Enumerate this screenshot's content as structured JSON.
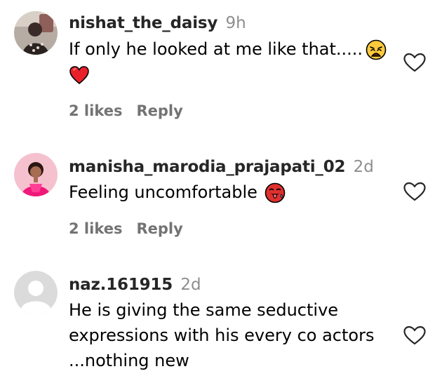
{
  "comments": [
    {
      "username": "nishat_the_daisy",
      "time": "9h",
      "text_lines": [
        "If only he looked at me like that....."
      ],
      "emojis": [
        "weary-face",
        "red-heart"
      ],
      "likes": "2 likes",
      "reply": "Reply"
    },
    {
      "username": "manisha_marodia_prajapati_02",
      "time": "2d",
      "text_lines": [
        "Feeling uncomfortable"
      ],
      "emojis": [
        "hot-face"
      ],
      "likes": "2 likes",
      "reply": "Reply"
    },
    {
      "username": "naz.161915",
      "time": "2d",
      "text_lines": [
        "He is giving the same seductive",
        "expressions with his every co actors",
        "...nothing new"
      ],
      "emojis": []
    }
  ],
  "icons": {
    "like": "heart-outline-icon",
    "default_avatar": "default-avatar-icon"
  },
  "colors": {
    "username": "#262626",
    "secondary": "#8e8e8e",
    "action": "#737373",
    "heart_outline": "#262626",
    "red_heart": "#e8202a",
    "hot_face": "#e0302e"
  }
}
